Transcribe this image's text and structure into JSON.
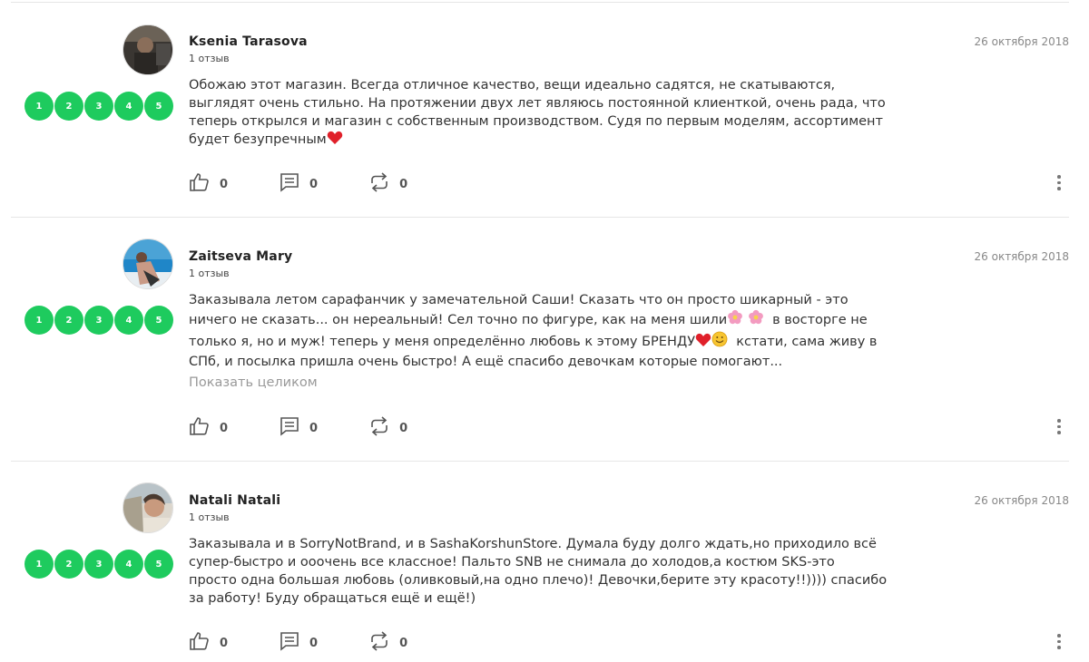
{
  "reviews": [
    {
      "name": "Ksenia Tarasova",
      "count": "1 отзыв",
      "date": "26 октября 2018",
      "stars": [
        "1",
        "2",
        "3",
        "4",
        "5"
      ],
      "text_lines": [
        "Обожаю этот магазин. Всегда отличное качество, вещи идеально садятся, не скатываются,",
        "выглядят очень стильно. На протяжении двух лет являюсь постоянной клиенткой, очень рада, что",
        "теперь открылся и магазин с собственным производством. Судя по первым моделям, ассортимент",
        "будет безупречным"
      ],
      "likes": "0",
      "comments": "0",
      "reposts": "0"
    },
    {
      "name": "Zaitseva Mary",
      "count": "1 отзыв",
      "date": "26 октября 2018",
      "stars": [
        "1",
        "2",
        "3",
        "4",
        "5"
      ],
      "text_lines": [
        "Заказывала летом сарафанчик у замечательной Саши! Сказать что он просто шикарный - это",
        "ничего не сказать... он нереальный! Сел точно по фигуре, как на меня шили",
        "в восторге не",
        "только я, но и муж! теперь у меня определённо любовь к этому БРЕНДУ",
        "кстати, сама живу в",
        "СПб, и посылка пришла очень быстро! А ещё спасибо девочкам которые помогают..."
      ],
      "show_more": "Показать целиком",
      "likes": "0",
      "comments": "0",
      "reposts": "0"
    },
    {
      "name": "Natali Natali",
      "count": "1 отзыв",
      "date": "26 октября 2018",
      "stars": [
        "1",
        "2",
        "3",
        "4",
        "5"
      ],
      "text_lines": [
        "Заказывала и в SorryNotBrand, и в SashaKorshunStore. Думала буду долго ждать,но приходило всё",
        "супер-быстро и ооочень все классное! Пальто SNB не снимала до холодов,а костюм SKS-это",
        "просто одна большая любовь (оливковый,на одно плечо)! Девочки,берите эту красоту!!)))) спасибо",
        "за работу! Буду обращаться ещё и ещё!)"
      ],
      "likes": "0",
      "comments": "0",
      "reposts": "0"
    }
  ],
  "colors": {
    "star": "#1ecb5e",
    "muted": "#888888",
    "text": "#333333"
  },
  "icons": [
    "like-icon",
    "comment-icon",
    "repost-icon",
    "more-icon",
    "heart-emoji",
    "flower-emoji",
    "smile-emoji"
  ]
}
